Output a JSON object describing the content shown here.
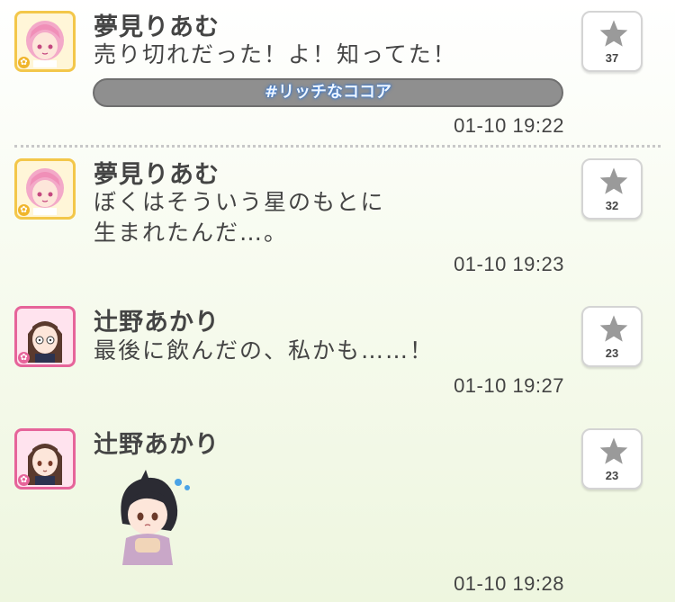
{
  "posts": [
    {
      "author": "夢見りあむ",
      "message": "売り切れだった！よ！知ってた！",
      "hashtag": "#リッチなココア",
      "timestamp": "01-10 19:22",
      "stars": "37",
      "frame_color": "#f3c74a"
    },
    {
      "author": "夢見りあむ",
      "message": "ぼくはそういう星のもとに\n生まれたんだ…。",
      "timestamp": "01-10 19:23",
      "stars": "32",
      "frame_color": "#f3c74a"
    },
    {
      "author": "辻野あかり",
      "message": "最後に飲んだの、私かも……！",
      "timestamp": "01-10 19:27",
      "stars": "23",
      "frame_color": "#e6649a"
    },
    {
      "author": "辻野あかり",
      "message": "",
      "timestamp": "01-10 19:28",
      "stars": "23",
      "frame_color": "#e6649a"
    }
  ],
  "colors": {
    "text": "#444444",
    "hashtag_glow": "#2a73d8",
    "star": "#9a9a9a"
  },
  "icons": [
    "star-icon",
    "avatar-image",
    "sticker-image"
  ]
}
